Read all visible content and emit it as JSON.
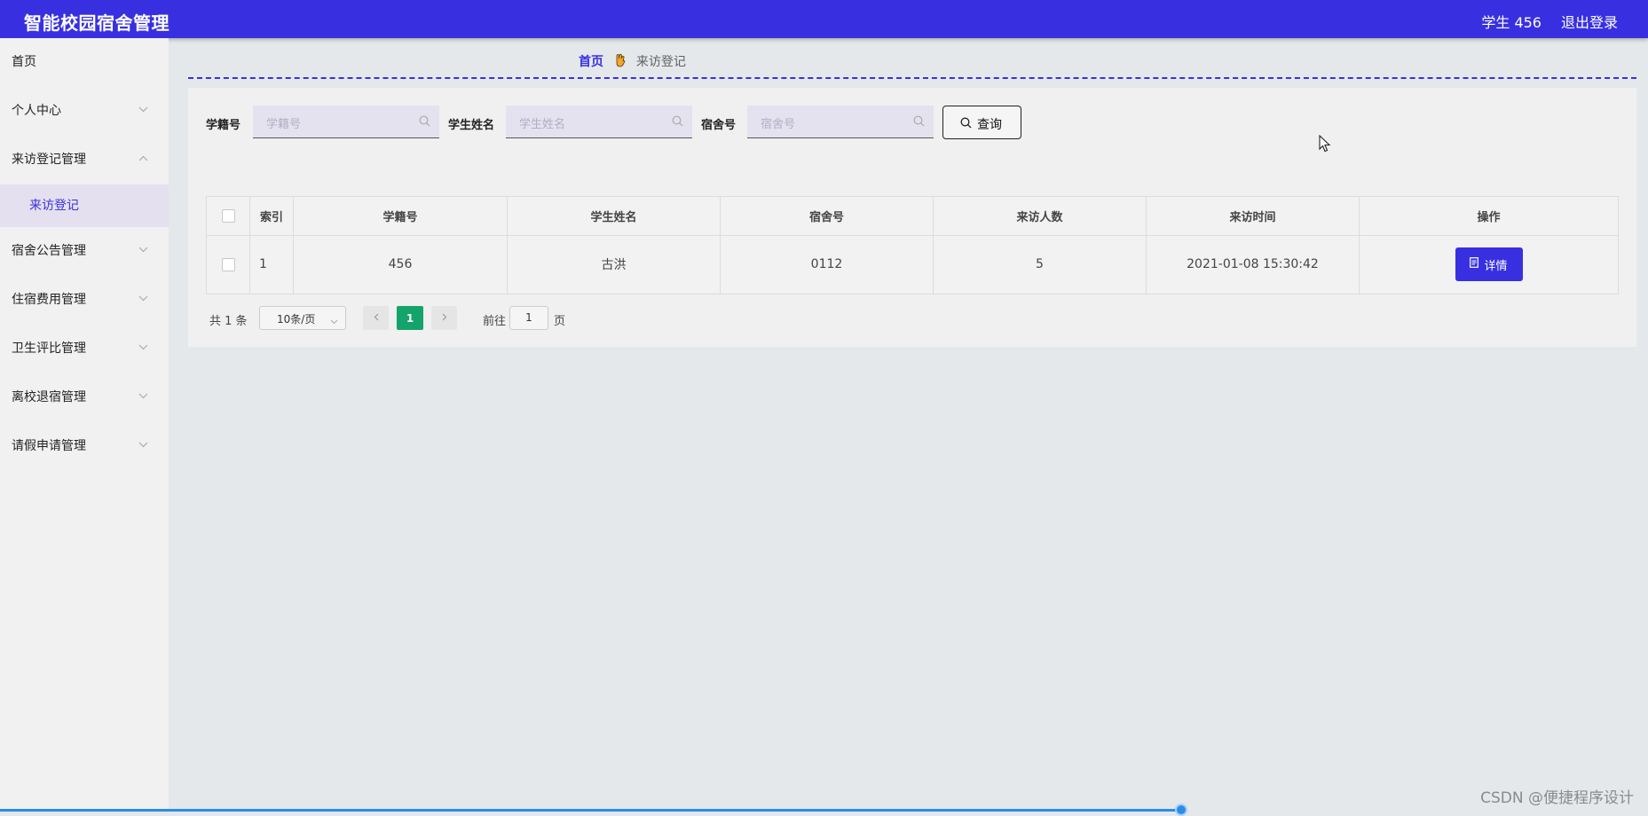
{
  "header": {
    "app_title": "智能校园宿舍管理",
    "user": "学生 456",
    "logout": "退出登录",
    "color": "#3830e0"
  },
  "sidebar": {
    "items": [
      {
        "label": "首页",
        "expandable": false
      },
      {
        "label": "个人中心",
        "expandable": true,
        "expanded": false
      },
      {
        "label": "来访登记管理",
        "expandable": true,
        "expanded": true
      },
      {
        "label": "宿舍公告管理",
        "expandable": true,
        "expanded": false
      },
      {
        "label": "住宿费用管理",
        "expandable": true,
        "expanded": false
      },
      {
        "label": "卫生评比管理",
        "expandable": true,
        "expanded": false
      },
      {
        "label": "离校退宿管理",
        "expandable": true,
        "expanded": false
      },
      {
        "label": "请假申请管理",
        "expandable": true,
        "expanded": false
      }
    ],
    "submenu": {
      "label": "来访登记",
      "parent": "来访登记管理",
      "active": true
    }
  },
  "breadcrumb": {
    "home": "首页",
    "current": "来访登记"
  },
  "search": {
    "student_id_label": "学籍号",
    "student_id_placeholder": "学籍号",
    "student_name_label": "学生姓名",
    "student_name_placeholder": "学生姓名",
    "dorm_label": "宿舍号",
    "dorm_placeholder": "宿舍号",
    "query_button": "查询"
  },
  "table": {
    "columns": [
      "索引",
      "学籍号",
      "学生姓名",
      "宿舍号",
      "来访人数",
      "来访时间",
      "操作"
    ],
    "rows": [
      {
        "index": "1",
        "student_id": "456",
        "student_name": "古洪",
        "dorm": "0112",
        "visitors": "5",
        "visit_time": "2021-01-08 15:30:42",
        "action": "详情"
      }
    ]
  },
  "pagination": {
    "total": "共 1 条",
    "page_size": "10条/页",
    "current_page": "1",
    "goto_prefix": "前往",
    "goto_value": "1",
    "goto_suffix": "页",
    "active_color": "#14a36b"
  },
  "watermark": "CSDN @便捷程序设计"
}
